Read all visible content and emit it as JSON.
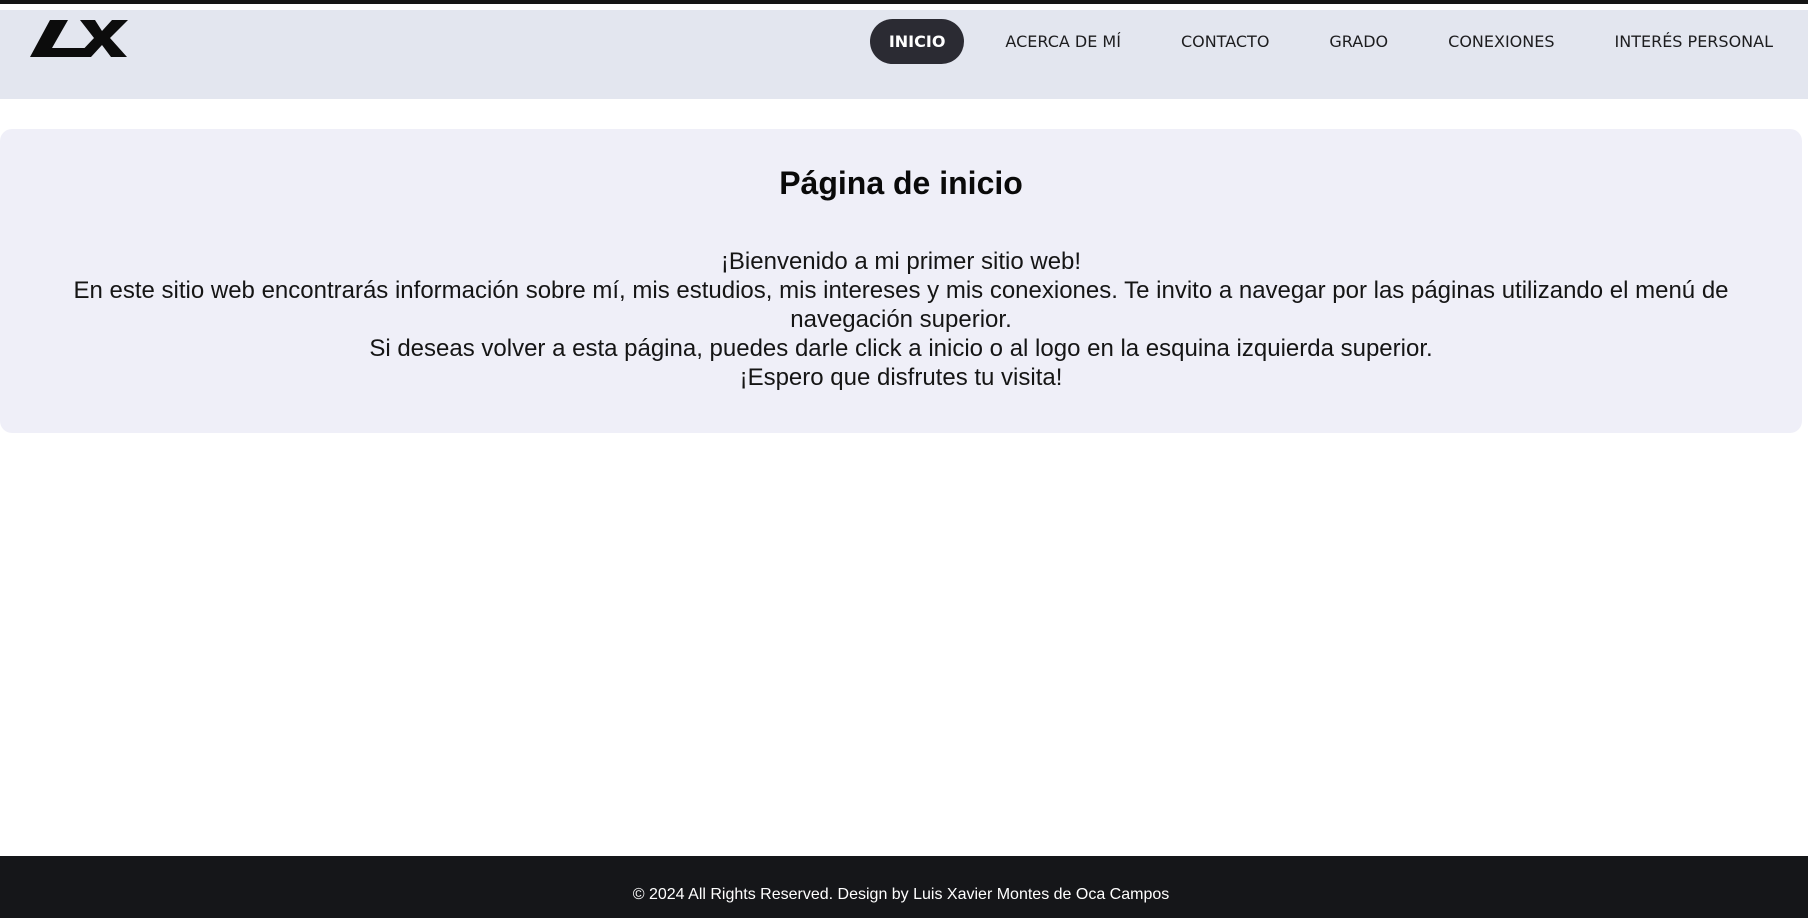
{
  "header": {
    "logo_icon": "lx-logo-icon",
    "nav": [
      {
        "label": "INICIO",
        "active": true
      },
      {
        "label": "ACERCA DE MÍ",
        "active": false
      },
      {
        "label": "CONTACTO",
        "active": false
      },
      {
        "label": "GRADO",
        "active": false
      },
      {
        "label": "CONEXIONES",
        "active": false
      },
      {
        "label": "INTERÉS PERSONAL",
        "active": false
      }
    ]
  },
  "main": {
    "title": "Página de inicio",
    "lines": [
      "¡Bienvenido a mi primer sitio web!",
      "En este sitio web encontrarás información sobre mí, mis estudios, mis intereses y mis conexiones. Te invito a navegar por las páginas utilizando el menú de navegación superior.",
      "Si deseas volver a esta página, puedes darle click a inicio o al logo en la esquina izquierda superior.",
      "¡Espero que disfrutes tu visita!"
    ]
  },
  "footer": {
    "text": "© 2024 All Rights Reserved. Design by Luis Xavier Montes de Oca Campos"
  },
  "colors": {
    "navbar_bg": "#e3e6ef",
    "active_pill": "#2b2b33",
    "card_bg": "#efeff8",
    "footer_bg": "#151619"
  }
}
